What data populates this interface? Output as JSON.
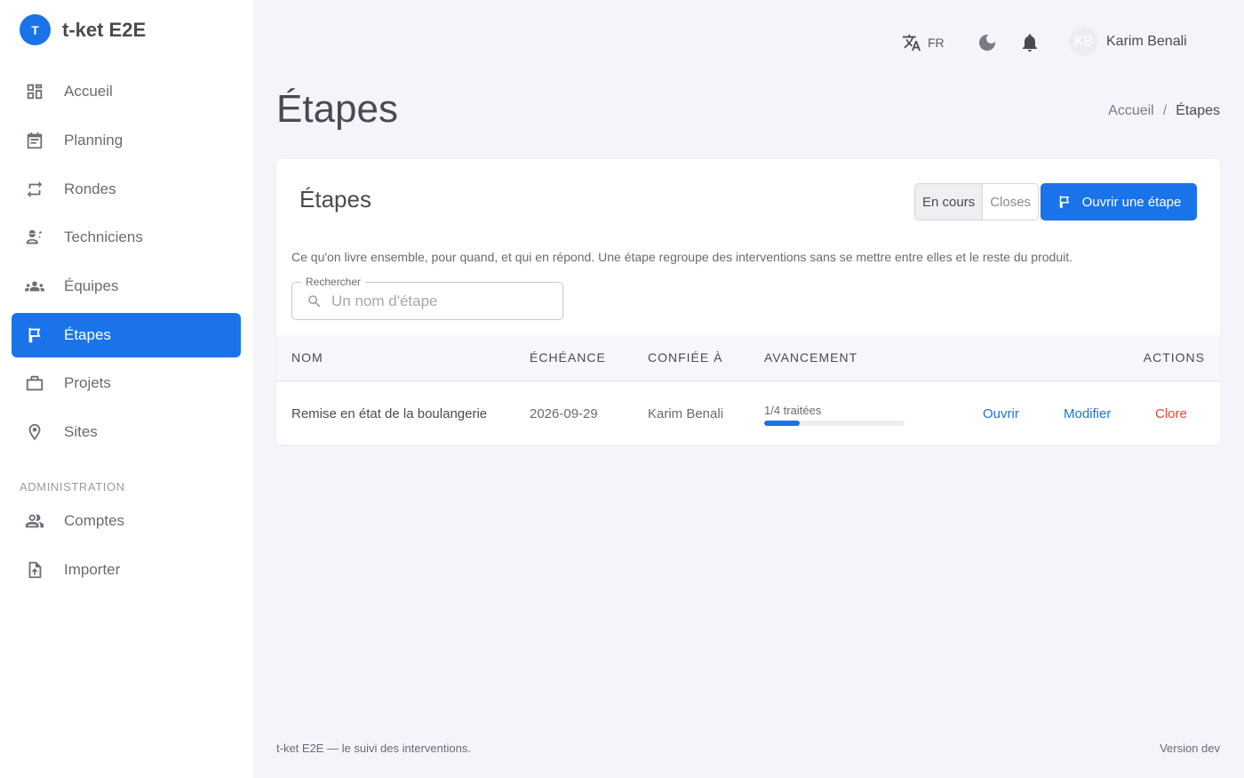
{
  "app": {
    "logo_letter": "T",
    "name": "t-ket E2E"
  },
  "sidebar": {
    "items": [
      {
        "label": "Accueil",
        "icon": "dashboard-icon"
      },
      {
        "label": "Planning",
        "icon": "calendar-icon"
      },
      {
        "label": "Rondes",
        "icon": "repeat-icon"
      },
      {
        "label": "Techniciens",
        "icon": "engineer-icon"
      },
      {
        "label": "Équipes",
        "icon": "groups-icon"
      },
      {
        "label": "Étapes",
        "icon": "flag-icon",
        "active": true
      },
      {
        "label": "Projets",
        "icon": "briefcase-icon"
      },
      {
        "label": "Sites",
        "icon": "location-pin-icon"
      }
    ],
    "admin_section_label": "ADMINISTRATION",
    "admin_items": [
      {
        "label": "Comptes",
        "icon": "people-icon"
      },
      {
        "label": "Importer",
        "icon": "file-upload-icon"
      }
    ]
  },
  "topbar": {
    "language": "FR",
    "language_icon": "translate-icon",
    "theme_icon": "moon-icon",
    "notifications_icon": "bell-icon",
    "user": {
      "initials": "KB",
      "name": "Karim Benali"
    }
  },
  "page": {
    "title": "Étapes",
    "breadcrumb": {
      "home": "Accueil",
      "separator": "/",
      "current": "Étapes"
    }
  },
  "card": {
    "title": "Étapes",
    "filter": {
      "options": [
        "En cours",
        "Closes"
      ],
      "selected": "En cours"
    },
    "primary_action": {
      "label": "Ouvrir une étape",
      "icon": "flag-icon"
    },
    "description": "Ce qu'on livre ensemble, pour quand, et qui en répond. Une étape regroupe des interventions sans se mettre entre elles et le reste du produit.",
    "search": {
      "label": "Rechercher",
      "placeholder": "Un nom d'étape",
      "value": ""
    },
    "table": {
      "columns": [
        "NOM",
        "ÉCHÉANCE",
        "CONFIÉE À",
        "AVANCEMENT",
        "ACTIONS"
      ],
      "rows": [
        {
          "name": "Remise en état de la boulangerie",
          "due": "2026-09-29",
          "assignee": "Karim Benali",
          "progress_label": "1/4 traitées",
          "progress_fraction": 0.25,
          "actions": {
            "open": "Ouvrir",
            "edit": "Modifier",
            "close": "Clore"
          }
        }
      ]
    }
  },
  "footer": {
    "left": "t-ket E2E — le suivi des interventions.",
    "right": "Version dev"
  },
  "colors": {
    "accent": "#1a73e8",
    "danger": "#ea4335",
    "background": "#f4f5fa"
  }
}
